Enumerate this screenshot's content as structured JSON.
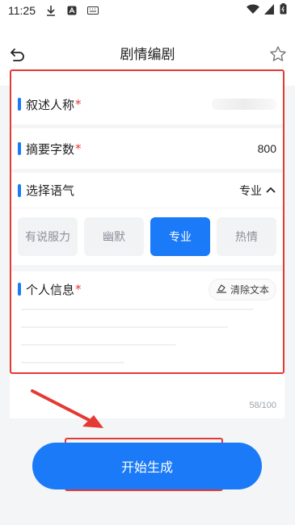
{
  "status_bar": {
    "time": "11:25"
  },
  "header": {
    "title": "剧情编剧"
  },
  "form": {
    "narrator": {
      "label": "叙述人称",
      "required_mark": "*"
    },
    "summary": {
      "label": "摘要字数",
      "required_mark": "*",
      "value": "800"
    },
    "tone": {
      "label": "选择语气",
      "selected": "专业",
      "options": [
        "有说服力",
        "幽默",
        "专业",
        "热情"
      ],
      "selected_index": 2
    },
    "personal_info": {
      "label": "个人信息",
      "required_mark": "*",
      "clear_label": "清除文本",
      "counter": "58/100"
    }
  },
  "actions": {
    "start_label": "开始生成"
  },
  "colors": {
    "accent": "#1a7af8",
    "required": "#e53935",
    "annotation": "#e53935"
  },
  "icons": [
    "download-icon",
    "a-icon",
    "keyboard-icon",
    "wifi-icon",
    "signal-icon",
    "battery-icon",
    "back-icon",
    "star-icon",
    "chevron-up-icon",
    "eraser-icon"
  ]
}
